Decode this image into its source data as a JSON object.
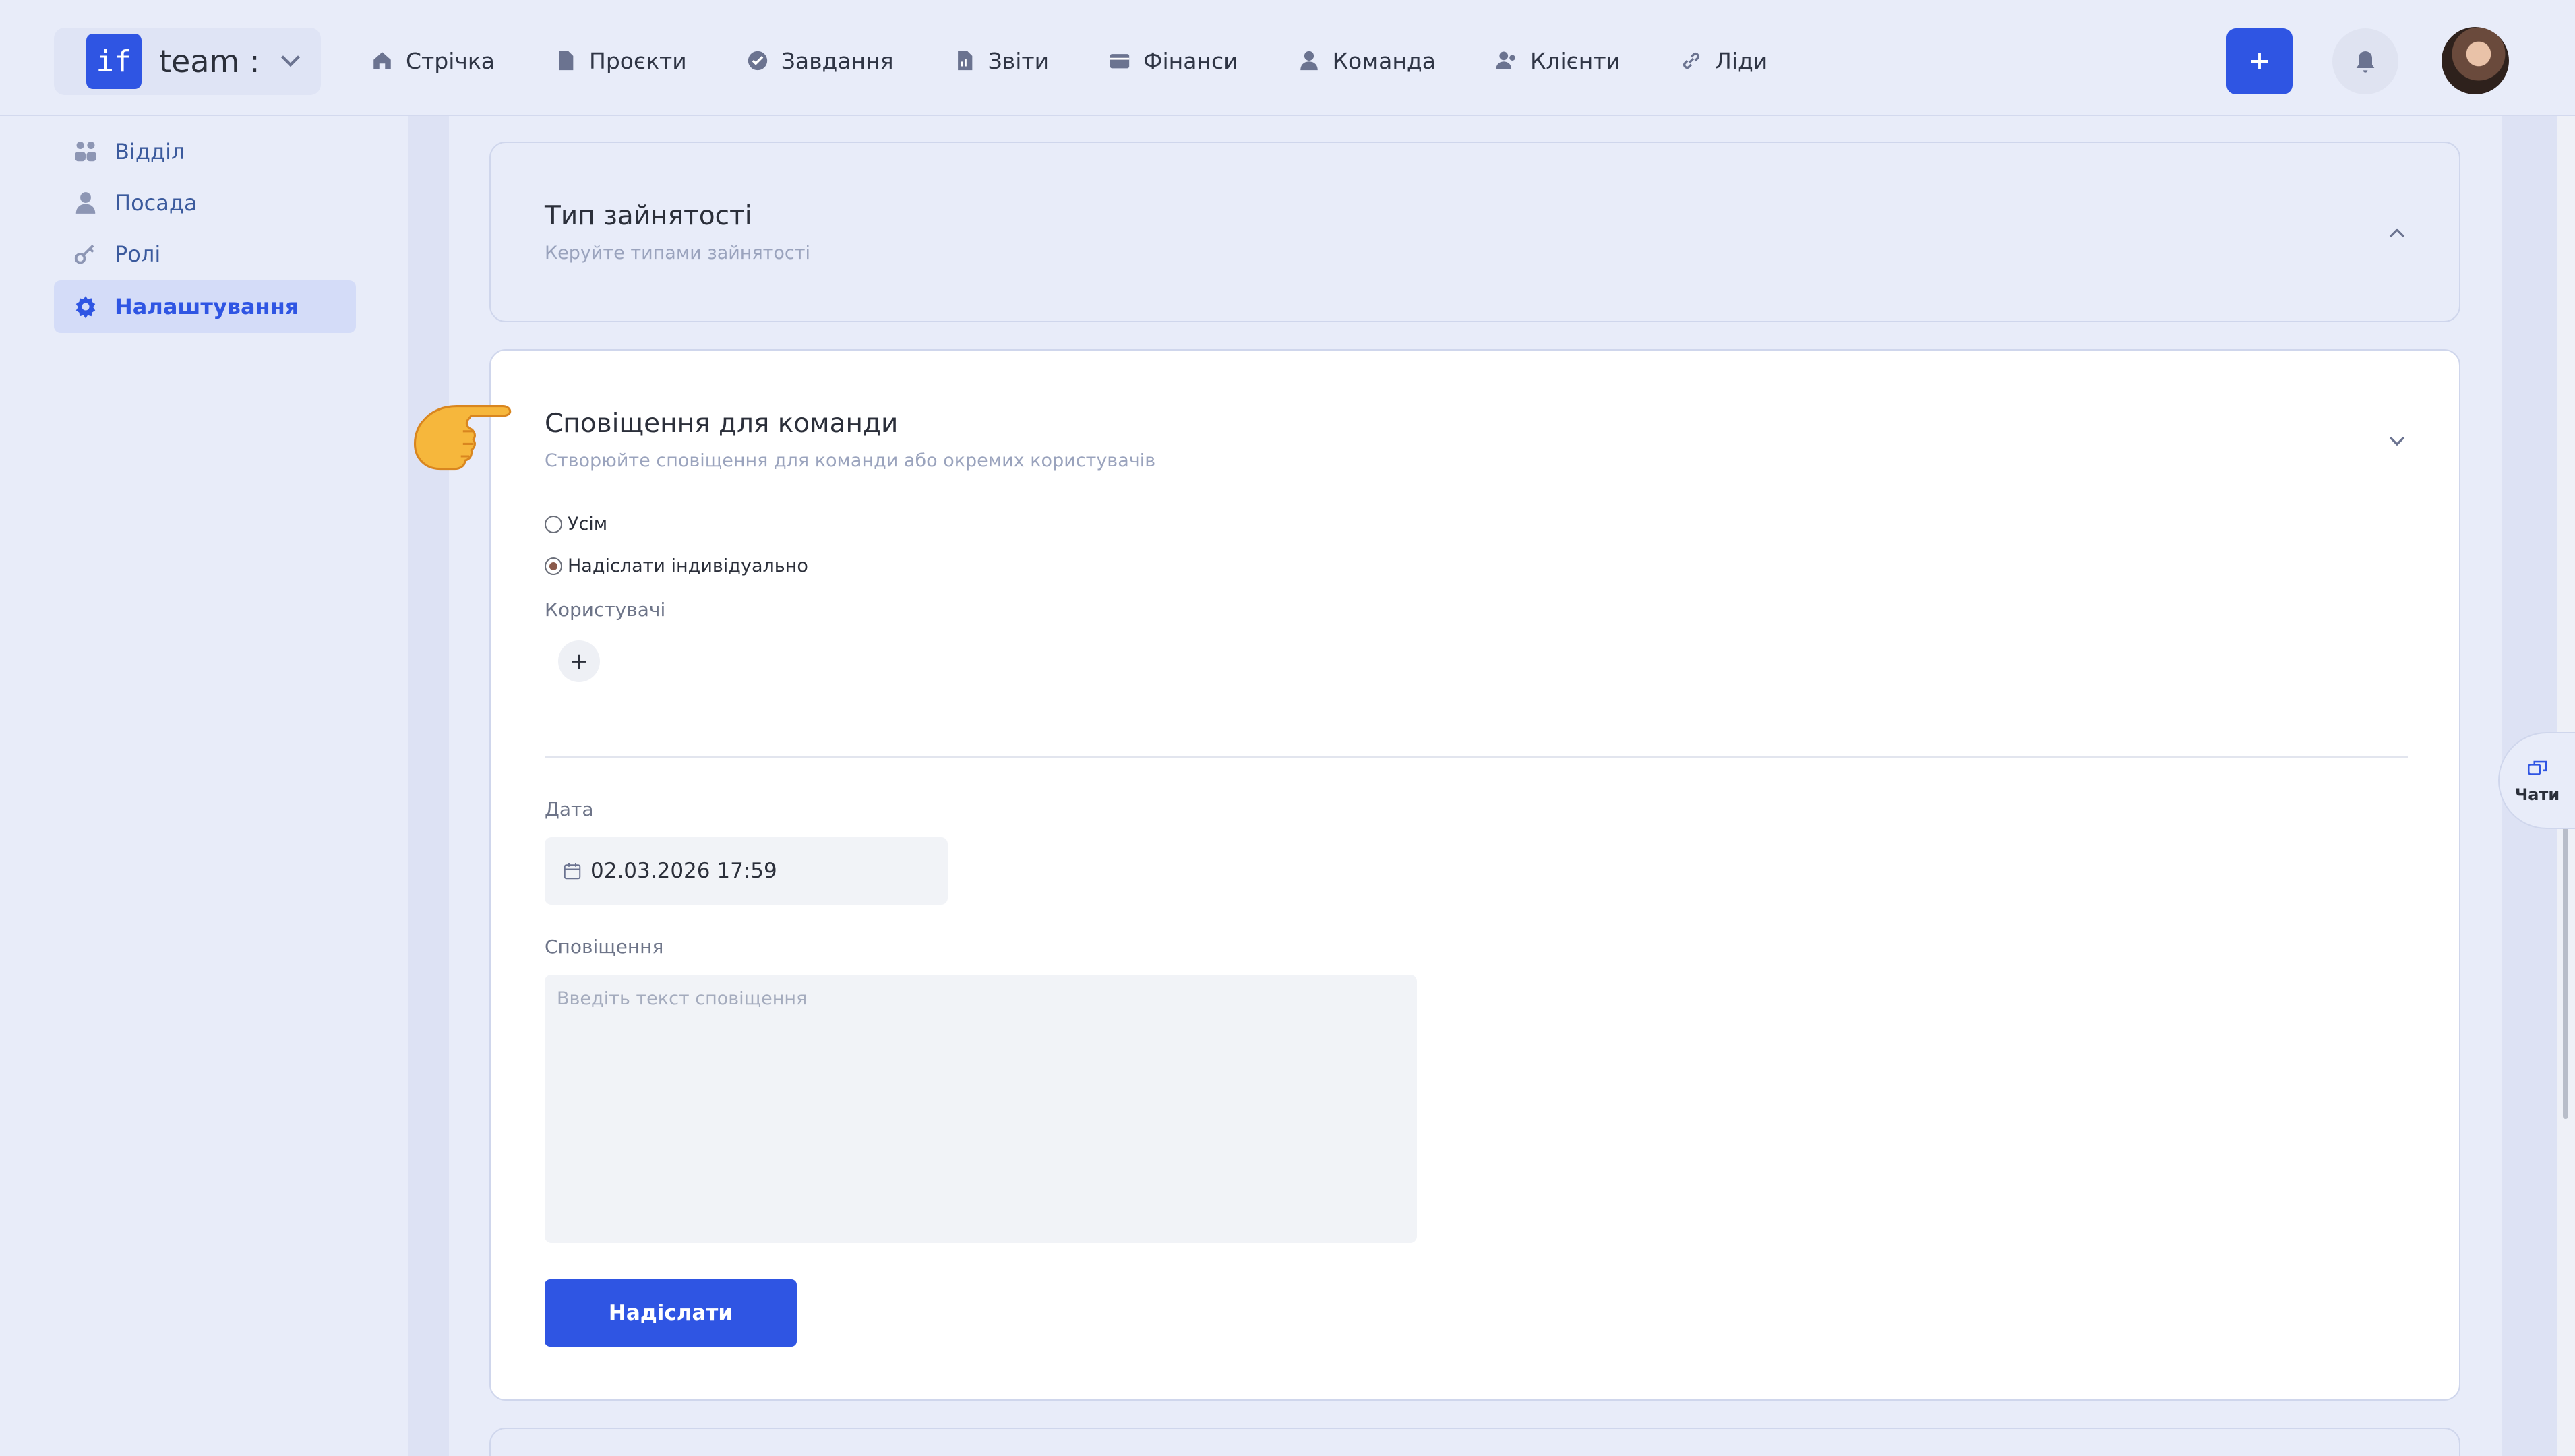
{
  "brand": {
    "logo_text": "if",
    "team_label": "team :"
  },
  "nav": [
    {
      "label": "Стрічка",
      "icon": "home-icon"
    },
    {
      "label": "Проєкти",
      "icon": "document-icon"
    },
    {
      "label": "Завдання",
      "icon": "check-circle-icon"
    },
    {
      "label": "Звіти",
      "icon": "report-icon"
    },
    {
      "label": "Фінанси",
      "icon": "wallet-icon"
    },
    {
      "label": "Команда",
      "icon": "user-icon"
    },
    {
      "label": "Клієнти",
      "icon": "users-icon"
    },
    {
      "label": "Ліди",
      "icon": "link-icon"
    }
  ],
  "header_actions": {
    "add_label": "+",
    "add_icon": "plus-icon",
    "notifications_icon": "bell-icon"
  },
  "sidebar": {
    "items": [
      {
        "label": "Відділ",
        "icon": "grid-people-icon",
        "active": false
      },
      {
        "label": "Посада",
        "icon": "user-icon",
        "active": false
      },
      {
        "label": "Ролі",
        "icon": "key-icon",
        "active": false
      },
      {
        "label": "Налаштування",
        "icon": "gear-icon",
        "active": true
      }
    ]
  },
  "employment_section": {
    "title": "Тип зайнятості",
    "subtitle": "Керуйте типами зайнятості",
    "expanded": false
  },
  "notifications_section": {
    "title": "Сповіщення для команди",
    "subtitle": "Створюйте сповіщення для команди або окремих користувачів",
    "expanded": true,
    "recipients": {
      "options": [
        {
          "label": "Усім",
          "checked": false
        },
        {
          "label": "Надіслати індивідуально",
          "checked": true
        }
      ]
    },
    "users_label": "Користувачі",
    "add_user_label": "+",
    "date_label": "Дата",
    "date_value": "02.03.2026 17:59",
    "message_label": "Сповіщення",
    "message_value": "",
    "message_placeholder": "Введіть текст сповіщення",
    "submit_label": "Надіслати"
  },
  "chat_tab": {
    "label": "Чати",
    "icon": "chat-icon"
  },
  "colors": {
    "accent": "#2f55e3",
    "background": "#e8ecf9",
    "card": "#ffffff"
  }
}
